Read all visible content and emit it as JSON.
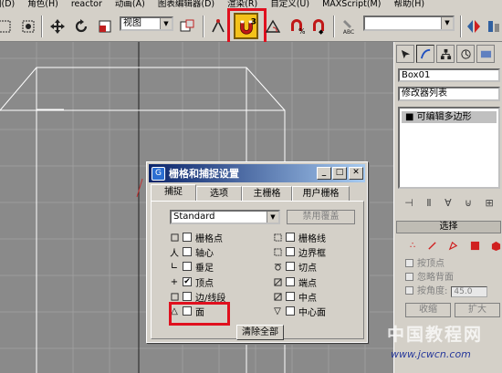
{
  "menubar": {
    "items": [
      "图(D)",
      "角色(H)",
      "reactor",
      "动画(A)",
      "图表编辑器(D)",
      "渲染(R)",
      "自定义(U)",
      "MAXScript(M)",
      "帮助(H)"
    ]
  },
  "toolbar": {
    "view_dropdown": "视图",
    "snap_badge": "3",
    "abc_label": "ABC"
  },
  "command_panel": {
    "object_name": "Box01",
    "modifier_list": "修改器列表",
    "stack_item": "可编辑多边形",
    "selection_rollout": {
      "title": "选择",
      "checks": [
        "按顶点",
        "忽略背面",
        "按角度:"
      ],
      "angle_value": "45.0",
      "shrink_label": "收缩",
      "grow_label": "扩大"
    }
  },
  "watermark": {
    "text": "中国教程网",
    "url": "www.jcwcn.com"
  },
  "dialog": {
    "title": "栅格和捕捉设置",
    "tabs": [
      "捕捉",
      "选项",
      "主栅格",
      "用户栅格"
    ],
    "active_tab": 0,
    "category_select": "Standard",
    "override_label": "禁用覆盖",
    "snaps_left": [
      {
        "label": "栅格点",
        "checked": false
      },
      {
        "label": "轴心",
        "checked": false
      },
      {
        "label": "垂足",
        "checked": false
      },
      {
        "label": "顶点",
        "checked": true
      },
      {
        "label": "边/线段",
        "checked": false
      },
      {
        "label": "面",
        "checked": false
      }
    ],
    "snaps_right": [
      {
        "label": "栅格线",
        "checked": false
      },
      {
        "label": "边界框",
        "checked": false
      },
      {
        "label": "切点",
        "checked": false
      },
      {
        "label": "端点",
        "checked": false
      },
      {
        "label": "中点",
        "checked": false
      },
      {
        "label": "中心面",
        "checked": false
      }
    ],
    "clear_all_label": "清除全部"
  },
  "colors": {
    "highlight_red": "#e0101e",
    "titlebar_start": "#0a246a",
    "titlebar_end": "#a6caf0",
    "viewport_bg": "#8a8a8a"
  }
}
